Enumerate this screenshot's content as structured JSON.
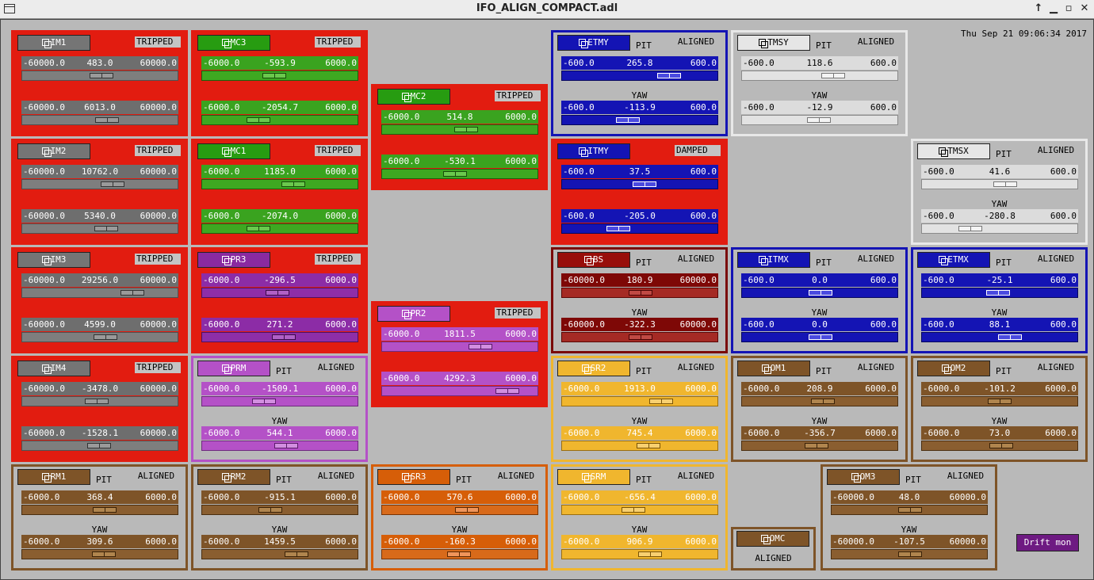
{
  "window": {
    "title": "IFO_ALIGN_COMPACT.adl",
    "datetime": "Thu Sep 21 09:06:34 2017",
    "buttons": {
      "up": "↑",
      "minimize": "▁",
      "maximize": "▫",
      "close": "✕"
    }
  },
  "themes": {
    "red": {
      "bg": "#e21c10",
      "border": "#e21c10",
      "btn": "#757575",
      "btnfg": "#ffffff",
      "val": "#6e6e6e",
      "valfg": "#ffffff",
      "trk": "#7e7e7e",
      "trkb": "#505050",
      "thumb": "#9a9a9a",
      "thb": "#333333",
      "lbl": "#c4c4c4",
      "lblfg": "#000000"
    },
    "red_green": {
      "bg": "#e21c10",
      "border": "#e21c10",
      "btn": "#279c11",
      "btnfg": "#ffffff",
      "val": "#3aa31f",
      "valfg": "#ffffff",
      "trk": "#3ea821",
      "trkb": "#1d5f0c",
      "thumb": "#6ac84d",
      "thb": "#174d0a",
      "lbl": "#c4c4c4",
      "lblfg": "#000000"
    },
    "red_purple": {
      "bg": "#e21c10",
      "border": "#e21c10",
      "btn": "#8a2aa0",
      "btnfg": "#ffffff",
      "val": "#8c2ca6",
      "valfg": "#ffffff",
      "trk": "#8e2ea8",
      "trkb": "#4e1060",
      "thumb": "#b060c6",
      "thb": "#3c0a4a",
      "lbl": "#c4c4c4",
      "lblfg": "#000000"
    },
    "red_violet": {
      "bg": "#e21c10",
      "border": "#e21c10",
      "btn": "#b451c7",
      "btnfg": "#ffffff",
      "val": "#b451c7",
      "valfg": "#ffffff",
      "trk": "#b451c7",
      "trkb": "#6e2a7e",
      "thumb": "#d28ee0",
      "thb": "#5a1a6a",
      "lbl": "#c4c4c4",
      "lblfg": "#000000"
    },
    "red_blue": {
      "bg": "#e21c10",
      "border": "#e21c10",
      "btn": "#1414b4",
      "btnfg": "#ffffff",
      "val": "#1414b4",
      "valfg": "#ffffff",
      "trk": "#1414b4",
      "trkb": "#06065e",
      "thumb": "#4a4ae0",
      "thb": "#ffffff",
      "lbl": "#c4c4c4",
      "lblfg": "#000000"
    },
    "violet": {
      "bg": "#b9b9b9",
      "border": "#b451c7",
      "btn": "#b451c7",
      "btnfg": "#ffffff",
      "val": "#b451c7",
      "valfg": "#ffffff",
      "trk": "#b451c7",
      "trkb": "#6e2a7e",
      "thumb": "#d28ee0",
      "thb": "#5a1a6a",
      "lbl": "#b9b9b9",
      "lblfg": "#000000"
    },
    "blue": {
      "bg": "#b9b9b9",
      "border": "#1414b4",
      "btn": "#1414b4",
      "btnfg": "#ffffff",
      "val": "#1414b4",
      "valfg": "#ffffff",
      "trk": "#1414b4",
      "trkb": "#06065e",
      "thumb": "#4a4ae0",
      "thb": "#ffffff",
      "lbl": "#b9b9b9",
      "lblfg": "#000000"
    },
    "white": {
      "bg": "#b9b9b9",
      "border": "#e8e8e8",
      "btn": "#e6e6e6",
      "btnfg": "#000000",
      "val": "#dcdcdc",
      "valfg": "#000000",
      "trk": "#e2e2e2",
      "trkb": "#8a8a8a",
      "thumb": "#f4f4f4",
      "thb": "#777777",
      "lbl": "#b9b9b9",
      "lblfg": "#000000"
    },
    "darkred": {
      "bg": "#b9b9b9",
      "border": "#7a0a08",
      "btn": "#980e0a",
      "btnfg": "#ffffff",
      "val": "#7e0806",
      "valfg": "#ffffff",
      "trk": "#a52a24",
      "trkb": "#5a0604",
      "thumb": "#c04a44",
      "thb": "#4a0404",
      "lbl": "#b9b9b9",
      "lblfg": "#000000"
    },
    "yellow": {
      "bg": "#b9b9b9",
      "border": "#f0b62e",
      "btn": "#f0b62e",
      "btnfg": "#ffffff",
      "val": "#f0b62e",
      "valfg": "#ffffff",
      "trk": "#f0b62e",
      "trkb": "#9a6e10",
      "thumb": "#f8d070",
      "thb": "#7a5406",
      "lbl": "#b9b9b9",
      "lblfg": "#000000"
    },
    "brown": {
      "bg": "#b9b9b9",
      "border": "#7e5428",
      "btn": "#7e5428",
      "btnfg": "#ffffff",
      "val": "#7e5428",
      "valfg": "#ffffff",
      "trk": "#8a5e30",
      "trkb": "#4a2e10",
      "thumb": "#b0854e",
      "thb": "#3a2208",
      "lbl": "#b9b9b9",
      "lblfg": "#000000"
    },
    "orange": {
      "bg": "#b9b9b9",
      "border": "#d65e08",
      "btn": "#d65e08",
      "btnfg": "#ffffff",
      "val": "#d65e08",
      "valfg": "#ffffff",
      "trk": "#d86a1a",
      "trkb": "#7a3404",
      "thumb": "#f0955a",
      "thb": "#5a2802",
      "lbl": "#b9b9b9",
      "lblfg": "#000000"
    }
  },
  "panels": [
    {
      "id": "IM1",
      "theme": "red",
      "status": "TRIPPED",
      "pit": false,
      "rows": [
        [
          "-60000.0",
          "483.0",
          "60000.0"
        ],
        [
          "-60000.0",
          "6013.0",
          "60000.0"
        ]
      ]
    },
    {
      "id": "IM2",
      "theme": "red",
      "status": "TRIPPED",
      "pit": false,
      "rows": [
        [
          "-60000.0",
          "10762.0",
          "60000.0"
        ],
        [
          "-60000.0",
          "5340.0",
          "60000.0"
        ]
      ]
    },
    {
      "id": "IM3",
      "theme": "red",
      "status": "TRIPPED",
      "pit": false,
      "rows": [
        [
          "-60000.0",
          "29256.0",
          "60000.0"
        ],
        [
          "-60000.0",
          "4599.0",
          "60000.0"
        ]
      ]
    },
    {
      "id": "IM4",
      "theme": "red",
      "status": "TRIPPED",
      "pit": false,
      "rows": [
        [
          "-60000.0",
          "-3478.0",
          "60000.0"
        ],
        [
          "-60000.0",
          "-1528.1",
          "60000.0"
        ]
      ]
    },
    {
      "id": "RM1",
      "theme": "brown",
      "status": "ALIGNED",
      "pit": true,
      "rows": [
        [
          "-6000.0",
          "368.4",
          "6000.0"
        ],
        [
          "-6000.0",
          "309.6",
          "6000.0"
        ]
      ]
    },
    {
      "id": "MC3",
      "theme": "red_green",
      "status": "TRIPPED",
      "pit": false,
      "rows": [
        [
          "-6000.0",
          "-593.9",
          "6000.0"
        ],
        [
          "-6000.0",
          "-2054.7",
          "6000.0"
        ]
      ]
    },
    {
      "id": "MC1",
      "theme": "red_green",
      "status": "TRIPPED",
      "pit": false,
      "rows": [
        [
          "-6000.0",
          "1185.0",
          "6000.0"
        ],
        [
          "-6000.0",
          "-2074.0",
          "6000.0"
        ]
      ]
    },
    {
      "id": "PR3",
      "theme": "red_purple",
      "status": "TRIPPED",
      "pit": false,
      "rows": [
        [
          "-6000.0",
          "-296.5",
          "6000.0"
        ],
        [
          "-6000.0",
          "271.2",
          "6000.0"
        ]
      ]
    },
    {
      "id": "PRM",
      "theme": "violet",
      "status": "ALIGNED",
      "pit": true,
      "rows": [
        [
          "-6000.0",
          "-1509.1",
          "6000.0"
        ],
        [
          "-6000.0",
          "544.1",
          "6000.0"
        ]
      ]
    },
    {
      "id": "RM2",
      "theme": "brown",
      "status": "ALIGNED",
      "pit": true,
      "rows": [
        [
          "-6000.0",
          "-915.1",
          "6000.0"
        ],
        [
          "-6000.0",
          "1459.5",
          "6000.0"
        ]
      ]
    },
    {
      "id": "MC2",
      "theme": "red_green",
      "status": "TRIPPED",
      "pit": false,
      "rows": [
        [
          "-6000.0",
          "514.8",
          "6000.0"
        ],
        [
          "-6000.0",
          "-530.1",
          "6000.0"
        ]
      ]
    },
    {
      "id": "PR2",
      "theme": "red_violet",
      "status": "TRIPPED",
      "pit": false,
      "rows": [
        [
          "-6000.0",
          "1811.5",
          "6000.0"
        ],
        [
          "-6000.0",
          "4292.3",
          "6000.0"
        ]
      ]
    },
    {
      "id": "SR3",
      "theme": "orange",
      "status": "ALIGNED",
      "pit": true,
      "rows": [
        [
          "-6000.0",
          "570.6",
          "6000.0"
        ],
        [
          "-6000.0",
          "-160.3",
          "6000.0"
        ]
      ]
    },
    {
      "id": "ETMY",
      "theme": "blue",
      "status": "ALIGNED",
      "pit": true,
      "rows": [
        [
          "-600.0",
          "265.8",
          "600.0"
        ],
        [
          "-600.0",
          "-113.9",
          "600.0"
        ]
      ]
    },
    {
      "id": "ITMY",
      "theme": "red_blue",
      "status": "DAMPED",
      "pit": false,
      "rows": [
        [
          "-600.0",
          "37.5",
          "600.0"
        ],
        [
          "-600.0",
          "-205.0",
          "600.0"
        ]
      ]
    },
    {
      "id": "BS",
      "theme": "darkred",
      "status": "ALIGNED",
      "pit": true,
      "rows": [
        [
          "-60000.0",
          "180.9",
          "60000.0"
        ],
        [
          "-60000.0",
          "-322.3",
          "60000.0"
        ]
      ]
    },
    {
      "id": "SR2",
      "theme": "yellow",
      "status": "ALIGNED",
      "pit": true,
      "rows": [
        [
          "-6000.0",
          "1913.0",
          "6000.0"
        ],
        [
          "-6000.0",
          "745.4",
          "6000.0"
        ]
      ]
    },
    {
      "id": "SRM",
      "theme": "yellow",
      "status": "ALIGNED",
      "pit": true,
      "rows": [
        [
          "-6000.0",
          "-656.4",
          "6000.0"
        ],
        [
          "-6000.0",
          "906.9",
          "6000.0"
        ]
      ]
    },
    {
      "id": "TMSY",
      "theme": "white",
      "status": "ALIGNED",
      "pit": true,
      "rows": [
        [
          "-600.0",
          "118.6",
          "600.0"
        ],
        [
          "-600.0",
          "-12.9",
          "600.0"
        ]
      ]
    },
    {
      "id": "ITMX",
      "theme": "blue",
      "status": "ALIGNED",
      "pit": true,
      "rows": [
        [
          "-600.0",
          "0.0",
          "600.0"
        ],
        [
          "-600.0",
          "0.0",
          "600.0"
        ]
      ]
    },
    {
      "id": "OM1",
      "theme": "brown",
      "status": "ALIGNED",
      "pit": true,
      "rows": [
        [
          "-6000.0",
          "208.9",
          "6000.0"
        ],
        [
          "-6000.0",
          "-356.7",
          "6000.0"
        ]
      ]
    },
    {
      "id": "OM3",
      "theme": "brown",
      "status": "ALIGNED",
      "pit": true,
      "rows": [
        [
          "-60000.0",
          "48.0",
          "60000.0"
        ],
        [
          "-60000.0",
          "-107.5",
          "60000.0"
        ]
      ]
    },
    {
      "id": "TMSX",
      "theme": "white",
      "status": "ALIGNED",
      "pit": true,
      "rows": [
        [
          "-600.0",
          "41.6",
          "600.0"
        ],
        [
          "-600.0",
          "-280.8",
          "600.0"
        ]
      ]
    },
    {
      "id": "ETMX",
      "theme": "blue",
      "status": "ALIGNED",
      "pit": true,
      "rows": [
        [
          "-600.0",
          "-25.1",
          "600.0"
        ],
        [
          "-600.0",
          "88.1",
          "600.0"
        ]
      ]
    },
    {
      "id": "OM2",
      "theme": "brown",
      "status": "ALIGNED",
      "pit": true,
      "rows": [
        [
          "-6000.0",
          "-101.2",
          "6000.0"
        ],
        [
          "-6000.0",
          "73.0",
          "6000.0"
        ]
      ]
    }
  ],
  "omc": {
    "id": "OMC",
    "status": "ALIGNED"
  },
  "labels": {
    "pit": "PIT",
    "yaw": "YAW"
  },
  "drift_button": {
    "label": "Drift mon"
  }
}
